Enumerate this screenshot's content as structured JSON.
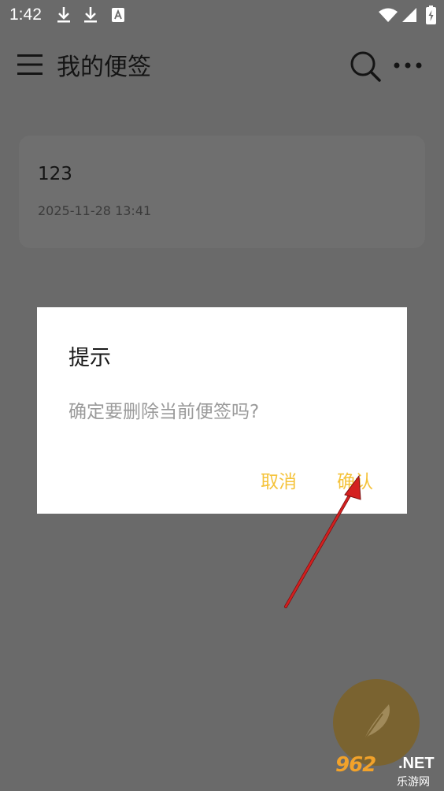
{
  "status_bar": {
    "time": "1:42",
    "icons": [
      "download-icon",
      "download-icon",
      "app-notification-icon",
      "wifi-icon",
      "signal-icon",
      "battery-icon"
    ]
  },
  "app_bar": {
    "title": "我的便签",
    "icons": [
      "menu-icon",
      "search-icon",
      "more-options-icon"
    ]
  },
  "notes": [
    {
      "title": "123",
      "timestamp": "2025-11-28 13:41"
    }
  ],
  "dialog": {
    "title": "提示",
    "message": "确定要删除当前便签吗?",
    "cancel_label": "取消",
    "confirm_label": "确认"
  },
  "fab": {
    "icon": "feather-pen-icon"
  },
  "watermark": {
    "main": "962",
    "net": ".NET",
    "sub": "乐游网"
  },
  "colors": {
    "overlay_background": "#6a6a6a",
    "dialog_background": "#ffffff",
    "accent": "#f5c33b",
    "fab": "#7a6330",
    "annotation_arrow": "#d42020"
  }
}
